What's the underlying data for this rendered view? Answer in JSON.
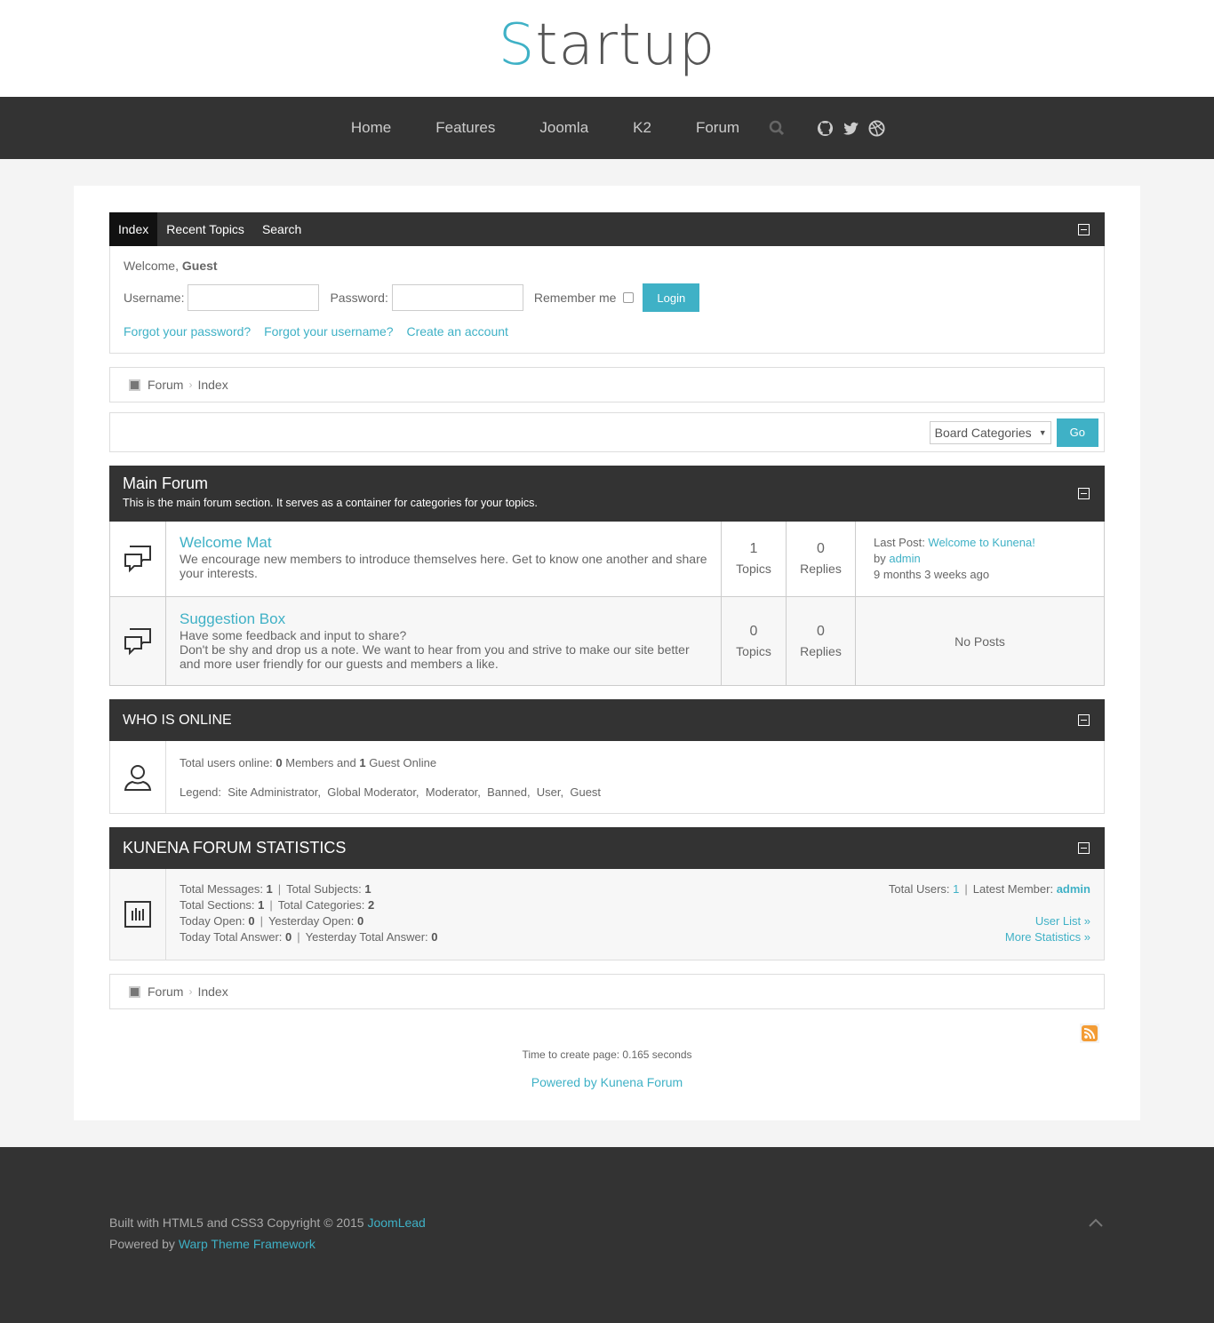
{
  "logo": {
    "first_letter": "S",
    "rest": "tartup"
  },
  "nav": {
    "items": [
      {
        "label": "Home"
      },
      {
        "label": "Features"
      },
      {
        "label": "Joomla"
      },
      {
        "label": "K2"
      },
      {
        "label": "Forum"
      }
    ]
  },
  "forum_tabs": [
    {
      "label": "Index"
    },
    {
      "label": "Recent Topics"
    },
    {
      "label": "Search"
    }
  ],
  "login": {
    "welcome_prefix": "Welcome, ",
    "welcome_user": "Guest",
    "username_label": "Username:",
    "password_label": "Password:",
    "remember_label": "Remember me",
    "login_button": "Login",
    "forgot_password": "Forgot your password?",
    "forgot_username": "Forgot your username?",
    "create_account": "Create an account"
  },
  "breadcrumb": {
    "root": "Forum",
    "current": "Index"
  },
  "jump": {
    "select_value": "Board Categories",
    "go_button": "Go"
  },
  "main_forum": {
    "title": "Main Forum",
    "description": "This is the main forum section. It serves as a container for categories for your topics.",
    "categories": [
      {
        "title": "Welcome Mat",
        "description": "We encourage new members to introduce themselves here. Get to know one another and share your interests.",
        "topics_count": "1",
        "topics_label": "Topics",
        "replies_count": "0",
        "replies_label": "Replies",
        "last_post_label": "Last Post: ",
        "last_post_link": "Welcome to Kunena!",
        "by_label": "by ",
        "by_user": "admin",
        "time": "9 months 3 weeks ago"
      },
      {
        "title": "Suggestion Box",
        "description_1": "Have some feedback and input to share?",
        "description_2": "Don't be shy and drop us a note. We want to hear from you and strive to make our site better and more user friendly for our guests and members a like.",
        "topics_count": "0",
        "topics_label": "Topics",
        "replies_count": "0",
        "replies_label": "Replies",
        "no_posts": "No Posts"
      }
    ]
  },
  "who_online": {
    "title": "WHO IS ONLINE",
    "total_prefix": "Total users online: ",
    "members_count": "0",
    "members_label": " Members and ",
    "guests_count": "1",
    "guests_label": " Guest Online",
    "legend": "Legend:  Site Administrator,  Global Moderator,  Moderator,  Banned,  User,  Guest"
  },
  "stats": {
    "title": "KUNENA FORUM STATISTICS",
    "total_messages_label": "Total Messages: ",
    "total_messages": "1",
    "total_subjects_label": "Total Subjects: ",
    "total_subjects": "1",
    "total_sections_label": "Total Sections: ",
    "total_sections": "1",
    "total_categories_label": "Total Categories: ",
    "total_categories": "2",
    "today_open_label": "Today Open: ",
    "today_open": "0",
    "yesterday_open_label": "Yesterday Open: ",
    "yesterday_open": "0",
    "today_answer_label": "Today Total Answer: ",
    "today_answer": "0",
    "yesterday_answer_label": "Yesterday Total Answer: ",
    "yesterday_answer": "0",
    "total_users_label": "Total Users: ",
    "total_users": "1",
    "latest_member_label": "Latest Member: ",
    "latest_member": "admin",
    "user_list": "User List »",
    "more_stats": "More Statistics »"
  },
  "page_time": "Time to create page: 0.165 seconds",
  "powered_by": "Powered by Kunena Forum",
  "footer": {
    "line1_prefix": "Built with HTML5 and CSS3 Copyright © 2015 ",
    "line1_link": "JoomLead",
    "line2_prefix": "Powered by ",
    "line2_link": "Warp Theme Framework"
  },
  "colors": {
    "accent": "#3fb1c6",
    "dark": "#333333"
  }
}
